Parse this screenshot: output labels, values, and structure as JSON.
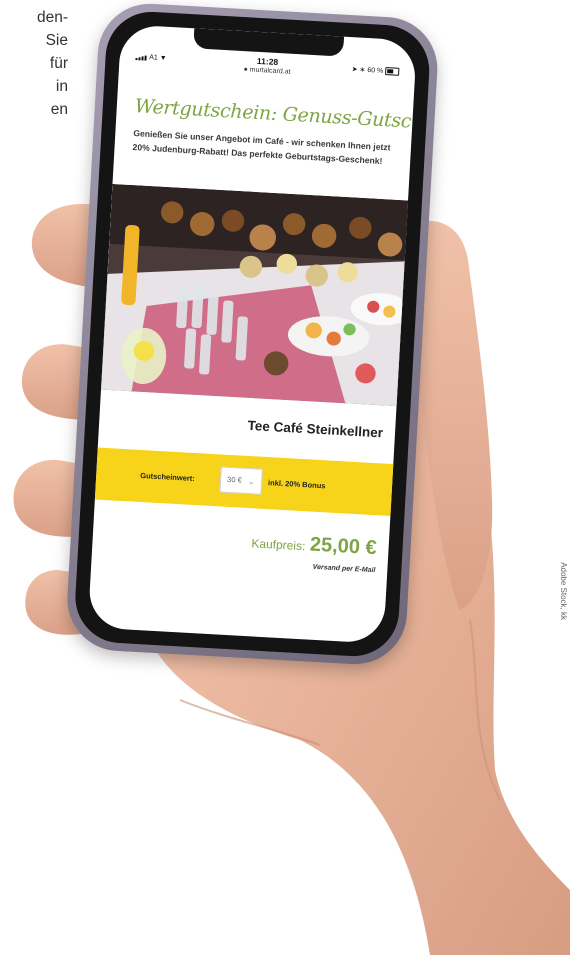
{
  "side_text": {
    "lines": [
      "den-",
      "Sie",
      "für",
      "in",
      "en"
    ]
  },
  "credit": "Adobe Stock, kk",
  "phone": {
    "status_bar": {
      "carrier": "A1",
      "time": "11:28",
      "url": "murtalcard.at",
      "battery": "60 %"
    },
    "page": {
      "title": "Wertgutschein: Genuss-Gutschein",
      "lead": "Genießen Sie unser Angebot im Café - wir schenken Ihnen jetzt 20% Judenburg-Rabatt! Das perfekte Geburtstags-Geschenk!",
      "photo_alt": "Buffet mit Törtchen und Gläsern",
      "cafe_name": "Tee Café Steinkellner",
      "voucher": {
        "label": "Gutscheinwert:",
        "selected_value": "30 €",
        "bonus": "inkl. 20% Bonus"
      },
      "price": {
        "label": "Kaufpreis:",
        "value": "25,00 €"
      },
      "shipping": "Versand per E-Mail"
    },
    "colors": {
      "accent_green": "#7fa443",
      "voucher_yellow": "#f7d319",
      "frame_purple": "#8c8598"
    }
  }
}
